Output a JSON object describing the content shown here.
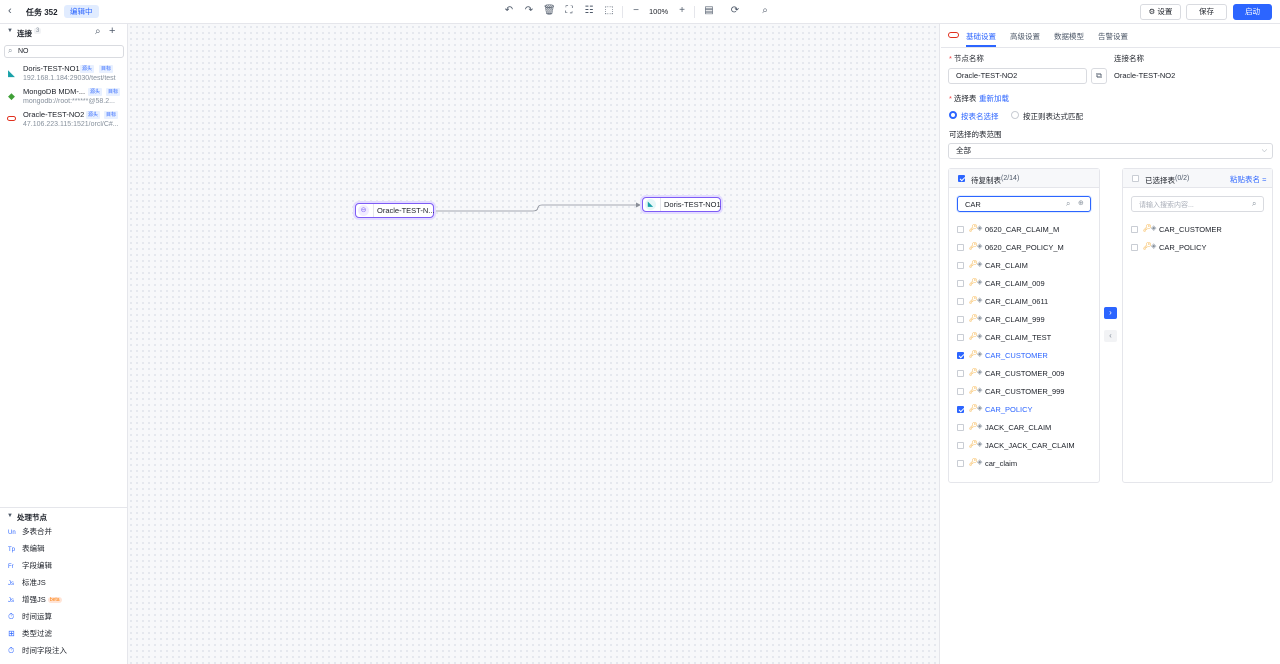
{
  "topbar": {
    "task_title": "任务 352",
    "status_badge": "编辑中",
    "zoom": "100%",
    "settings_label": "设置",
    "save_label": "保存",
    "start_label": "启动"
  },
  "sidebar": {
    "connections_title": "连接",
    "connections_count": "3",
    "search_value": "NO",
    "connections": [
      {
        "name": "Doris-TEST-NO1",
        "address": "192.168.1.184:29030/test/test",
        "tag_source": "源头",
        "tag_target": "目标"
      },
      {
        "name": "MongoDB MDM-...",
        "address": "mongodb://root:******@58.2...",
        "tag_source": "源头",
        "tag_target": "目标"
      },
      {
        "name": "Oracle-TEST-NO2",
        "address": "47.106.223.115:1521/orcl/C#...",
        "tag_source": "源头",
        "tag_target": "目标"
      }
    ],
    "process_title": "处理节点",
    "process_nodes": [
      {
        "abbr": "Un",
        "label": "多表合并"
      },
      {
        "abbr": "Tp",
        "label": "表编辑"
      },
      {
        "abbr": "Fr",
        "label": "字段编辑"
      },
      {
        "abbr": "Js",
        "label": "标准JS"
      },
      {
        "abbr": "Js",
        "label": "增强JS",
        "badge": "beta"
      },
      {
        "abbr": "⏱",
        "label": "时间运算"
      },
      {
        "abbr": "⊞",
        "label": "类型过滤"
      },
      {
        "abbr": "⏱",
        "label": "时间字段注入"
      }
    ]
  },
  "canvas": {
    "source_node": "Oracle-TEST-N...",
    "target_node": "Doris-TEST-NO1"
  },
  "panel": {
    "tabs": [
      "基础设置",
      "高级设置",
      "数据模型",
      "告警设置"
    ],
    "node_name_label": "节点名称",
    "node_name_value": "Oracle-TEST-NO2",
    "conn_name_label": "连接名称",
    "conn_name_value": "Oracle-TEST-NO2",
    "select_table_label": "选择表",
    "reload_label": "重新加载",
    "radio_by_name": "按表名选择",
    "radio_by_regex": "按正则表达式匹配",
    "range_label": "可选择的表范围",
    "range_value": "全部",
    "pending_title": "待复制表",
    "pending_count": "(2/14)",
    "pending_search": "CAR",
    "selected_title": "已选择表",
    "selected_count": "(0/2)",
    "paste_label": "粘贴表名",
    "selected_search_placeholder": "请输入搜索内容...",
    "pending_tables": [
      {
        "name": "0620_CAR_CLAIM_M",
        "checked": false
      },
      {
        "name": "0620_CAR_POLICY_M",
        "checked": false
      },
      {
        "name": "CAR_CLAIM",
        "checked": false
      },
      {
        "name": "CAR_CLAIM_009",
        "checked": false
      },
      {
        "name": "CAR_CLAIM_0611",
        "checked": false
      },
      {
        "name": "CAR_CLAIM_999",
        "checked": false
      },
      {
        "name": "CAR_CLAIM_TEST",
        "checked": false
      },
      {
        "name": "CAR_CUSTOMER",
        "checked": true
      },
      {
        "name": "CAR_CUSTOMER_009",
        "checked": false
      },
      {
        "name": "CAR_CUSTOMER_999",
        "checked": false
      },
      {
        "name": "CAR_POLICY",
        "checked": true
      },
      {
        "name": "JACK_CAR_CLAIM",
        "checked": false
      },
      {
        "name": "JACK_JACK_CAR_CLAIM",
        "checked": false
      },
      {
        "name": "car_claim",
        "checked": false
      }
    ],
    "selected_tables": [
      {
        "name": "CAR_CUSTOMER"
      },
      {
        "name": "CAR_POLICY"
      }
    ]
  }
}
